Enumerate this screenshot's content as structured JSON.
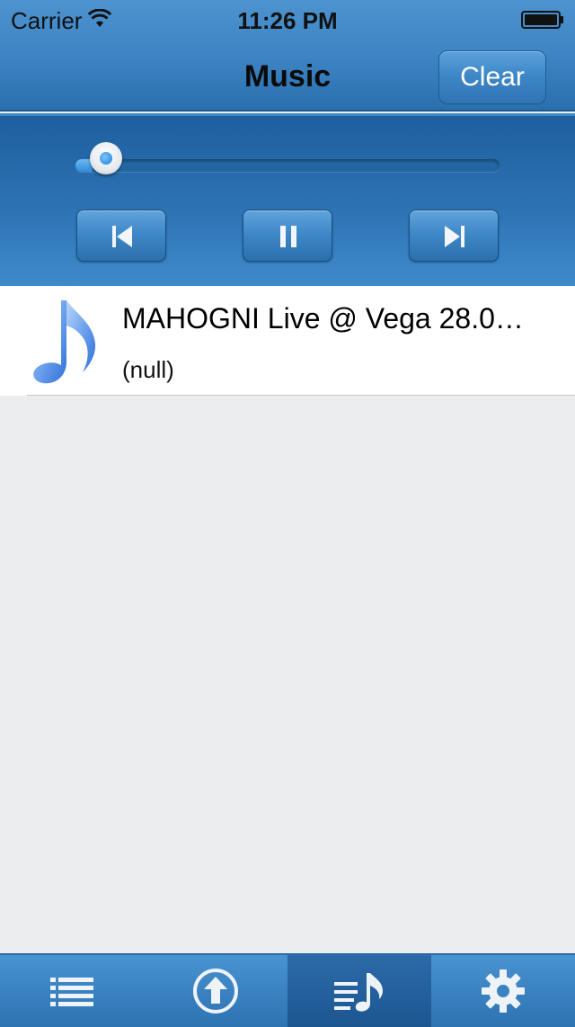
{
  "status_bar": {
    "carrier": "Carrier",
    "time": "11:26 PM",
    "wifi_icon": "wifi-icon",
    "battery_icon": "battery-icon"
  },
  "nav": {
    "title": "Music",
    "clear_label": "Clear"
  },
  "player": {
    "progress_fraction": 0.04,
    "controls": [
      "previous-track-icon",
      "pause-icon",
      "next-track-icon"
    ]
  },
  "tracks": [
    {
      "title": "MAHOGNI Live @ Vega 28.0…",
      "subtitle": "(null)",
      "icon": "music-note-icon"
    }
  ],
  "tab_bar": {
    "items": [
      "list-icon",
      "upload-icon",
      "playlist-icon",
      "gear-icon"
    ],
    "selected_index": 2
  },
  "colors": {
    "accent": "#3b83c2",
    "background": "#ecedef"
  }
}
